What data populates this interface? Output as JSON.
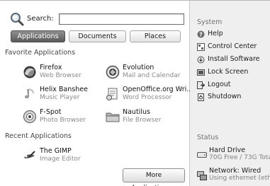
{
  "search": {
    "label": "Search:",
    "value": ""
  },
  "tabs": [
    {
      "label": "Applications",
      "active": true
    },
    {
      "label": "Documents",
      "active": false
    },
    {
      "label": "Places",
      "active": false
    }
  ],
  "favorites": {
    "title": "Favorite Applications",
    "apps": [
      {
        "name": "Firefox",
        "desc": "Web Browser",
        "icon": "firefox-icon"
      },
      {
        "name": "Evolution",
        "desc": "Mail and Calendar",
        "icon": "evolution-icon"
      },
      {
        "name": "Helix Banshee",
        "desc": "Music Player",
        "icon": "banshee-icon"
      },
      {
        "name": "OpenOffice.org Wri...",
        "desc": "Word Processor",
        "icon": "openoffice-writer-icon"
      },
      {
        "name": "F-Spot",
        "desc": "Photo Browser",
        "icon": "f-spot-icon"
      },
      {
        "name": "Nautilus",
        "desc": "File Browser",
        "icon": "folder-icon"
      }
    ]
  },
  "recent": {
    "title": "Recent Applications",
    "apps": [
      {
        "name": "The GIMP",
        "desc": "Image Editor",
        "icon": "gimp-icon"
      }
    ]
  },
  "more_button": "More Applications...",
  "system": {
    "title": "System",
    "items": [
      {
        "label": "Help",
        "icon": "help-icon"
      },
      {
        "label": "Control Center",
        "icon": "control-center-icon"
      },
      {
        "label": "Install Software",
        "icon": "install-software-icon"
      },
      {
        "label": "Lock Screen",
        "icon": "lock-screen-icon"
      },
      {
        "label": "Logout",
        "icon": "logout-icon"
      },
      {
        "label": "Shutdown",
        "icon": "shutdown-icon"
      }
    ]
  },
  "status": {
    "title": "Status",
    "items": [
      {
        "label": "Hard Drive",
        "sub": "70G Free / 73G Total",
        "icon": "hard-drive-icon"
      },
      {
        "label": "Network: Wired",
        "sub": "Using ethernet (eth0)",
        "icon": "network-icon"
      }
    ]
  }
}
